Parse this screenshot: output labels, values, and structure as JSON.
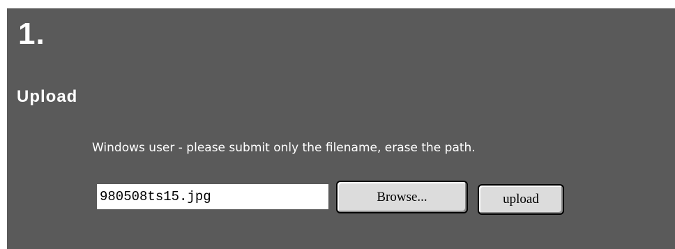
{
  "step": {
    "number": "1."
  },
  "section": {
    "title": "Upload"
  },
  "hint": {
    "text": "Windows user - please submit only the filename, erase the path."
  },
  "file_field": {
    "value": "980508ts15.jpg"
  },
  "buttons": {
    "browse_label": "Browse...",
    "upload_label": "upload"
  },
  "colors": {
    "panel_background": "#5a5a5a",
    "text": "#ffffff",
    "button_face": "#dcdcdc"
  }
}
